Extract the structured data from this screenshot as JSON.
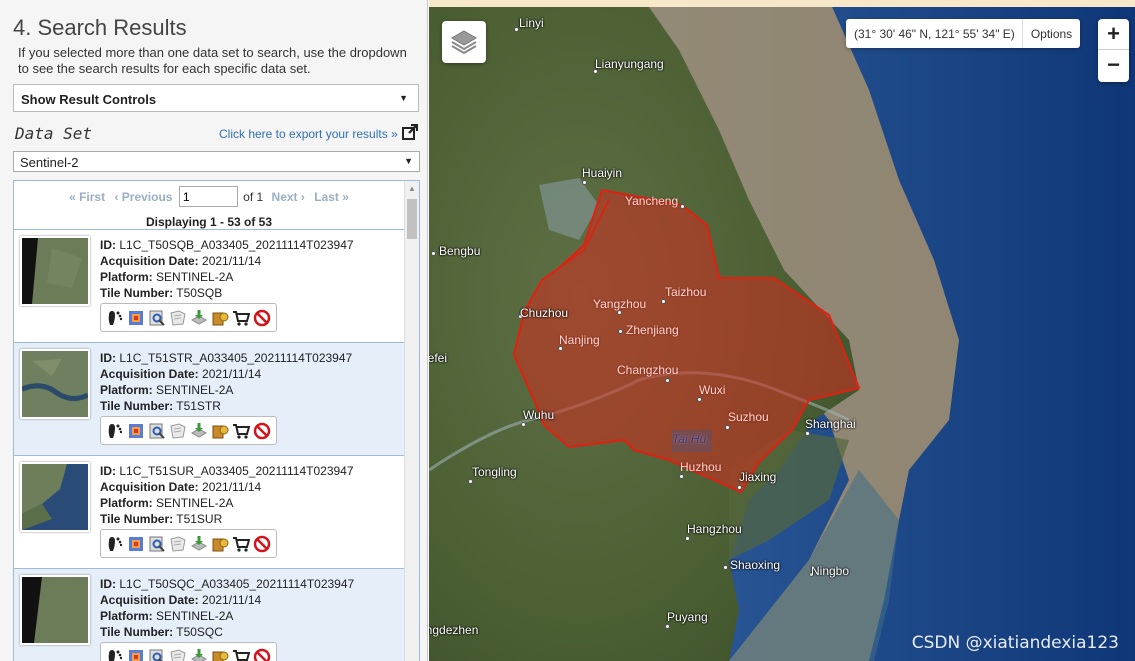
{
  "panel": {
    "title": "4. Search Results",
    "description": "If you selected more than one data set to search, use the dropdown to see the search results for each specific data set.",
    "result_controls_label": "Show Result Controls",
    "dataset_label": "Data Set",
    "export_link": "Click here to export your results »",
    "dataset_value": "Sentinel-2"
  },
  "pager": {
    "first": "« First",
    "previous": "‹ Previous",
    "page_value": "1",
    "of_label": "of 1",
    "next": "Next ›",
    "last": "Last »",
    "displaying_prefix": "Displaying",
    "displaying_range": "1 - 53",
    "displaying_suffix": "of 53"
  },
  "result_labels": {
    "id": "ID:",
    "acquisition": "Acquisition Date:",
    "platform": "Platform:",
    "tile": "Tile Number:"
  },
  "results": [
    {
      "id": "L1C_T50SQB_A033405_20211114T023947",
      "date": "2021/11/14",
      "platform": "SENTINEL-2A",
      "tile": "T50SQB"
    },
    {
      "id": "L1C_T51STR_A033405_20211114T023947",
      "date": "2021/11/14",
      "platform": "SENTINEL-2A",
      "tile": "T51STR"
    },
    {
      "id": "L1C_T51SUR_A033405_20211114T023947",
      "date": "2021/11/14",
      "platform": "SENTINEL-2A",
      "tile": "T51SUR"
    },
    {
      "id": "L1C_T50SQC_A033405_20211114T023947",
      "date": "2021/11/14",
      "platform": "SENTINEL-2A",
      "tile": "T50SQC"
    }
  ],
  "action_icons": [
    "footprint-icon",
    "overlay-icon",
    "metadata-icon",
    "compare-icon",
    "download-icon",
    "order-icon",
    "cart-icon",
    "exclude-icon"
  ],
  "map": {
    "coordinates": "(31° 30' 46\" N, 121° 55' 34\" E)",
    "options_label": "Options",
    "zoom_in": "+",
    "zoom_out": "−",
    "cities": [
      {
        "name": "Linyi",
        "style": "w"
      },
      {
        "name": "Lianyungang",
        "style": "w"
      },
      {
        "name": "Huaiyin",
        "style": "w"
      },
      {
        "name": "Yancheng",
        "style": "r"
      },
      {
        "name": "Bengbu",
        "style": "w"
      },
      {
        "name": "Chuzhou",
        "style": "w"
      },
      {
        "name": "Yangzhou",
        "style": "r"
      },
      {
        "name": "Taizhou",
        "style": "r"
      },
      {
        "name": "Zhenjiang",
        "style": "r"
      },
      {
        "name": "Nanjing",
        "style": "r"
      },
      {
        "name": "Hefei",
        "style": "w"
      },
      {
        "name": "Changzhou",
        "style": "r"
      },
      {
        "name": "Wuxi",
        "style": "r"
      },
      {
        "name": "Suzhou",
        "style": "r"
      },
      {
        "name": "Wuhu",
        "style": "w"
      },
      {
        "name": "Tai Hu",
        "style": "b"
      },
      {
        "name": "Shanghai",
        "style": "w"
      },
      {
        "name": "Huzhou",
        "style": "r"
      },
      {
        "name": "Jiaxing",
        "style": "w"
      },
      {
        "name": "Tongling",
        "style": "w"
      },
      {
        "name": "Hangzhou",
        "style": "w"
      },
      {
        "name": "Shaoxing",
        "style": "w"
      },
      {
        "name": "Ningbo",
        "style": "w"
      },
      {
        "name": "Puyang",
        "style": "w"
      },
      {
        "name": "Jingdezhen",
        "style": "w"
      }
    ],
    "watermark": "CSDN @xiatiandexia123"
  }
}
